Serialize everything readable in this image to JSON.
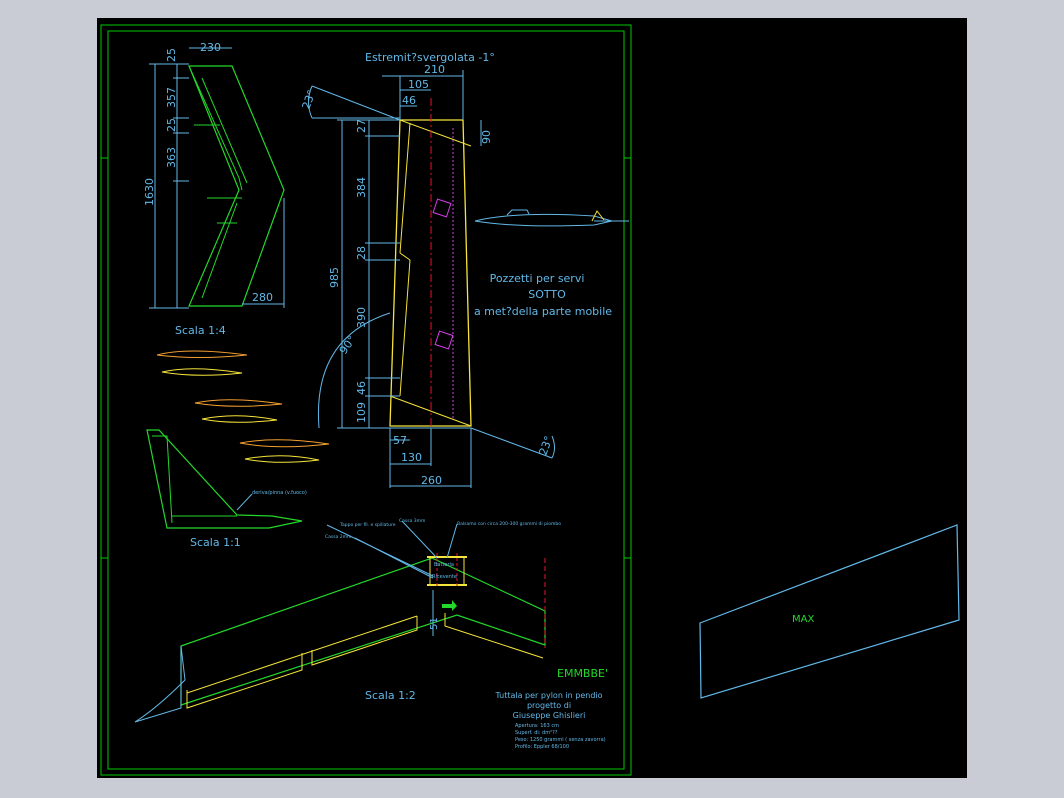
{
  "colors": {
    "background": "#c9ccd4",
    "canvas": "#000000",
    "frame": "#00c800",
    "outline_green": "#23d82a",
    "outline_yellow": "#f5e43a",
    "dimension": "#62b8e8",
    "centerline_red": "#e0142b",
    "annotation_cyan": "#4fd9ea",
    "hatch_magenta": "#d23fe6"
  },
  "top_view": {
    "dims": {
      "tip_chord": "230",
      "top_gap": "25",
      "seg1": "357",
      "gap2": "25",
      "seg2": "363",
      "span": "1630",
      "root_chord": "280"
    },
    "scale": "Scala 1:4"
  },
  "panel": {
    "title": "Estremit?svergolata -1°",
    "dims": {
      "width_top": "210",
      "w105": "105",
      "w46": "46",
      "d27": "27",
      "d90": "90",
      "d384": "384",
      "d28": "28",
      "d985": "985",
      "d390": "390",
      "d46": "46",
      "d109": "109",
      "w57": "57",
      "w130": "130",
      "w260": "260",
      "angle_top": "23°",
      "angle_bottom": "23°",
      "angle_90": "90°"
    },
    "note_lines": [
      "Pozzetti per servi",
      "SOTTO",
      "a met?della parte mobile"
    ]
  },
  "fin_view": {
    "label": "deriva/pinna (v.fuoco)",
    "scale": "Scala 1:1"
  },
  "iso_view": {
    "labels": {
      "a": "Tappo per fil. e spillature",
      "b": "Cassa 3mm",
      "c": "Balsamo con circa 200-300 grammi di piombo",
      "d": "Cassa 2mm",
      "e": "Batteria",
      "f": "Ricevente"
    },
    "dim_51": "51",
    "scale": "Scala 1:2"
  },
  "title_block": {
    "brand": "EMMBBE'",
    "lines": [
      "Tuttala per pylon in pendio",
      "progetto di",
      "Giuseppe Ghislieri"
    ],
    "specs": [
      "Apertura: 163 cm",
      "Superf. di: dm²??",
      "Peso: 1250 grammi ( senza zavorra)",
      "Profilo: Eppler 68/100"
    ]
  },
  "max_label": "MAX"
}
